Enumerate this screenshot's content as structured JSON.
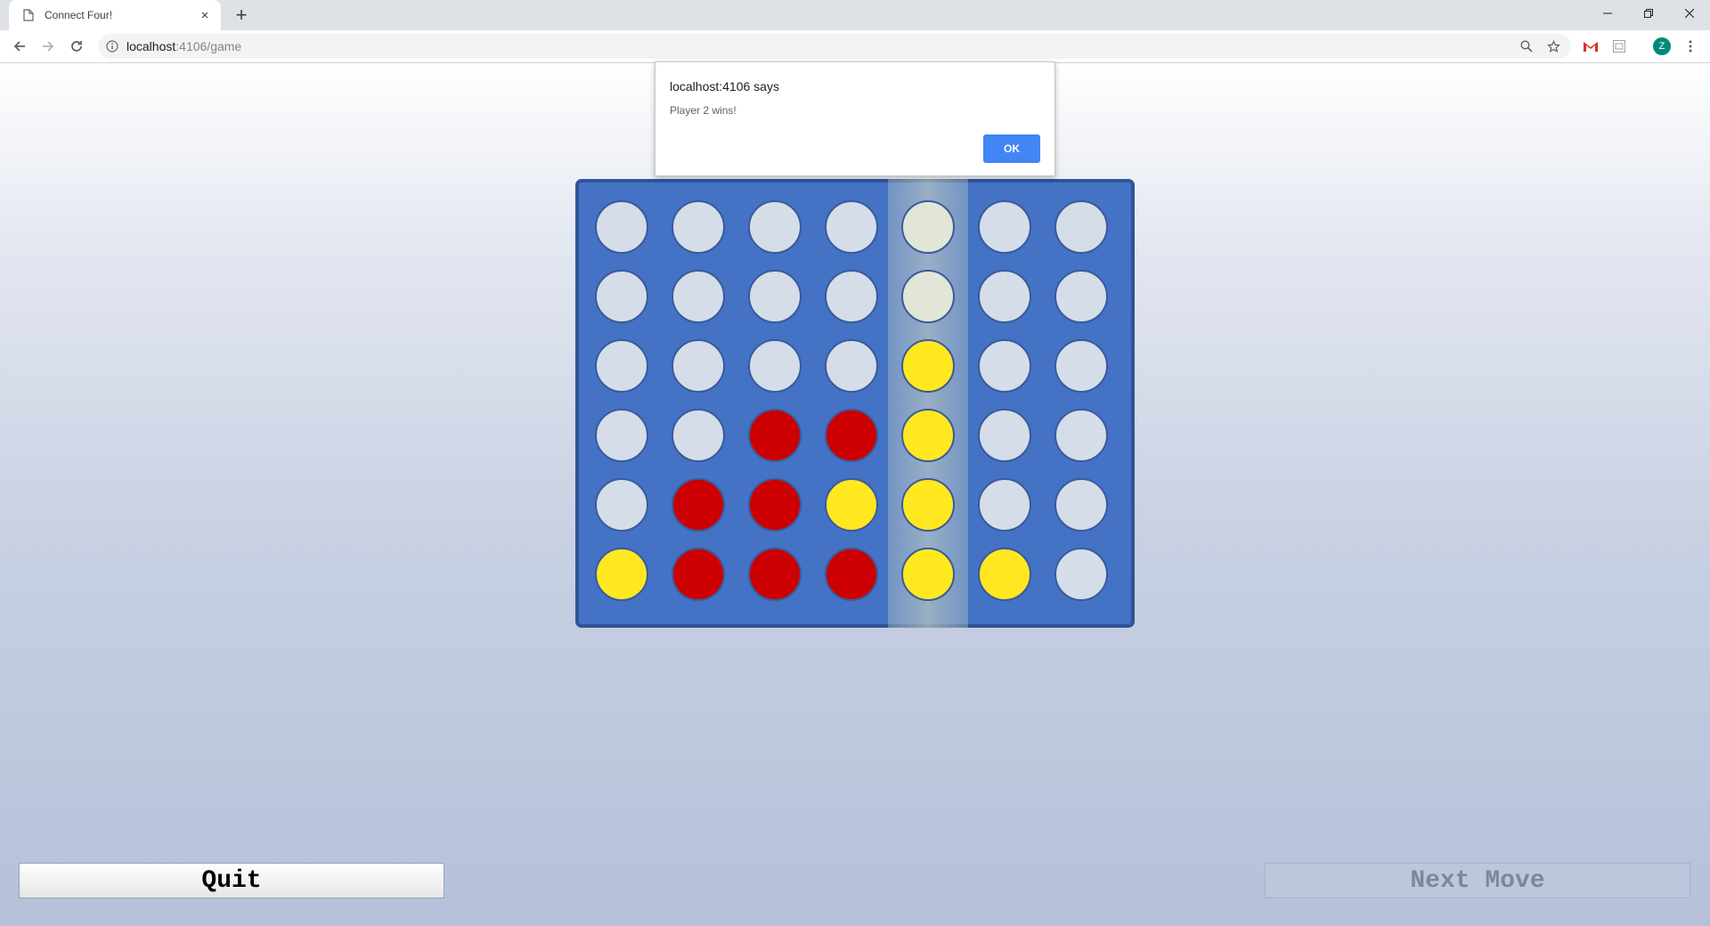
{
  "browser": {
    "tab_title": "Connect Four!",
    "new_tab": "+",
    "tab_close": "×",
    "url_host": "localhost",
    "url_path": ":4106/game",
    "avatar_letter": "Z"
  },
  "alert": {
    "title": "localhost:4106 says",
    "message": "Player 2 wins!",
    "ok_label": "OK"
  },
  "game": {
    "highlighted_column": 4,
    "board": [
      [
        "empty",
        "empty",
        "empty",
        "empty",
        "tint",
        "empty",
        "empty"
      ],
      [
        "empty",
        "empty",
        "empty",
        "empty",
        "tint",
        "empty",
        "empty"
      ],
      [
        "empty",
        "empty",
        "empty",
        "empty",
        "yellow",
        "empty",
        "empty"
      ],
      [
        "empty",
        "empty",
        "red",
        "red",
        "yellow",
        "empty",
        "empty"
      ],
      [
        "empty",
        "red",
        "red",
        "yellow",
        "yellow",
        "empty",
        "empty"
      ],
      [
        "yellow",
        "red",
        "red",
        "red",
        "yellow",
        "yellow",
        "empty"
      ]
    ],
    "colors": {
      "board": "#4472c4",
      "red": "#cc0000",
      "yellow": "#ffe81f",
      "empty": "#d5dde9"
    }
  },
  "controls": {
    "quit_label": "Quit",
    "next_label": "Next Move"
  }
}
